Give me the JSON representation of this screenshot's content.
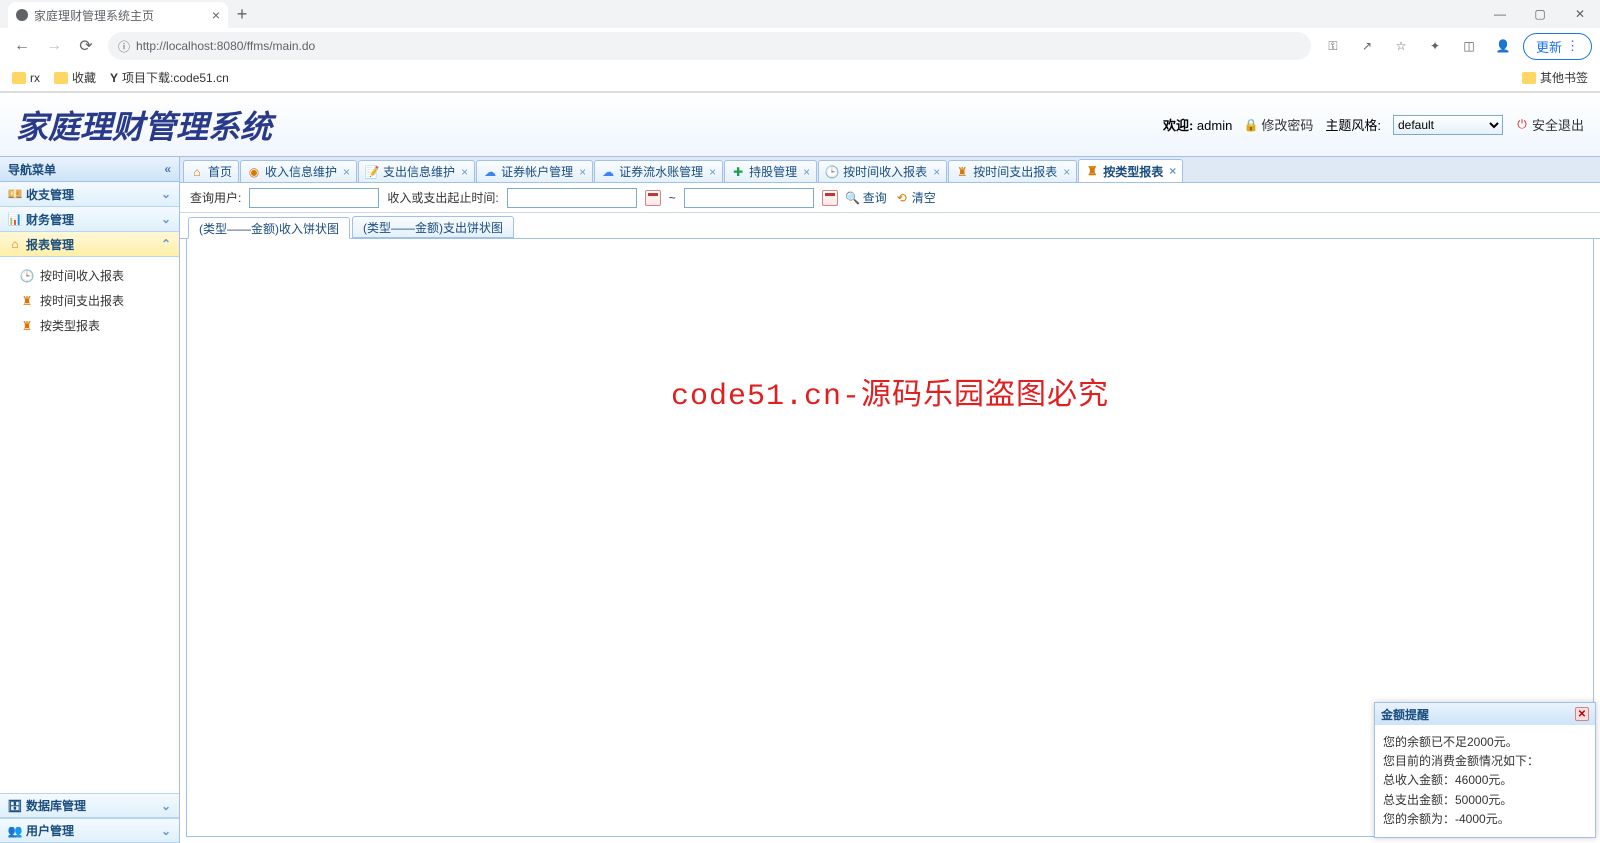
{
  "browser": {
    "tab_title": "家庭理财管理系统主页",
    "url": "http://localhost:8080/ffms/main.do",
    "update_label": "更新",
    "bookmarks": {
      "rx": "rx",
      "fav": "收藏",
      "dl": "项目下载:code51.cn",
      "other": "其他书签"
    }
  },
  "header": {
    "title": "家庭理财管理系统",
    "welcome": "欢迎:",
    "user": "admin",
    "change_pwd": "修改密码",
    "theme_label": "主题风格:",
    "theme_value": "default",
    "logout": "安全退出"
  },
  "sidebar": {
    "nav_title": "导航菜单",
    "items": [
      {
        "label": "收支管理",
        "active": false
      },
      {
        "label": "财务管理",
        "active": false
      },
      {
        "label": "报表管理",
        "active": true
      }
    ],
    "sub_items": [
      {
        "label": "按时间收入报表"
      },
      {
        "label": "按时间支出报表"
      },
      {
        "label": "按类型报表"
      }
    ],
    "bottom": [
      {
        "label": "数据库管理"
      },
      {
        "label": "用户管理"
      }
    ]
  },
  "tabs": [
    {
      "label": "首页",
      "closable": false
    },
    {
      "label": "收入信息维护",
      "closable": true
    },
    {
      "label": "支出信息维护",
      "closable": true
    },
    {
      "label": "证券帐户管理",
      "closable": true
    },
    {
      "label": "证券流水账管理",
      "closable": true
    },
    {
      "label": "持股管理",
      "closable": true
    },
    {
      "label": "按时间收入报表",
      "closable": true
    },
    {
      "label": "按时间支出报表",
      "closable": true
    },
    {
      "label": "按类型报表",
      "closable": true,
      "active": true
    }
  ],
  "toolbar": {
    "user_label": "查询用户:",
    "time_label": "收入或支出起止时间:",
    "sep": "~",
    "search": "查询",
    "clear": "清空"
  },
  "sub_tabs": [
    {
      "label": "(类型——金额)收入饼状图",
      "active": true
    },
    {
      "label": "(类型——金额)支出饼状图",
      "active": false
    }
  ],
  "watermark": "code51.cn-源码乐园盗图必究",
  "notify": {
    "title": "金额提醒",
    "line1": "您的余额已不足2000元。",
    "line2": "您目前的消费金额情况如下：",
    "line3": "总收入金额：46000元。",
    "line4": "总支出金额：50000元。",
    "line5": "您的余额为：-4000元。"
  }
}
